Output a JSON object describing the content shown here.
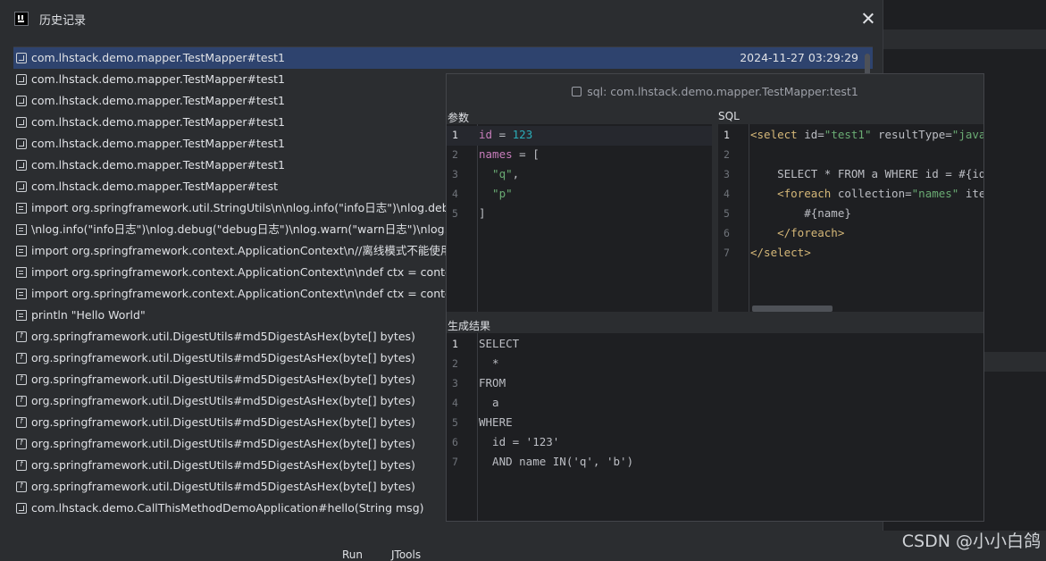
{
  "dialog": {
    "title": "历史记录",
    "close_icon": "close-icon"
  },
  "history": {
    "items": [
      {
        "icon": "class-icon",
        "label": "com.lhstack.demo.mapper.TestMapper#test1",
        "time": "2024-11-27 03:29:29",
        "selected": true
      },
      {
        "icon": "class-icon",
        "label": "com.lhstack.demo.mapper.TestMapper#test1"
      },
      {
        "icon": "class-icon",
        "label": "com.lhstack.demo.mapper.TestMapper#test1"
      },
      {
        "icon": "class-icon",
        "label": "com.lhstack.demo.mapper.TestMapper#test1"
      },
      {
        "icon": "class-icon",
        "label": "com.lhstack.demo.mapper.TestMapper#test1"
      },
      {
        "icon": "class-icon",
        "label": "com.lhstack.demo.mapper.TestMapper#test1"
      },
      {
        "icon": "class-icon",
        "label": "com.lhstack.demo.mapper.TestMapper#test"
      },
      {
        "icon": "script-icon",
        "label": "import org.springframework.util.StringUtils\\n\\nlog.info(\"info日志\")\\nlog.debug(\"debug日志\")"
      },
      {
        "icon": "script-icon",
        "label": "\\nlog.info(\"info日志\")\\nlog.debug(\"debug日志\")\\nlog.warn(\"warn日志\")\\nlog.error(\"error\")"
      },
      {
        "icon": "script-icon",
        "label": "import org.springframework.context.ApplicationContext\\n//离线模式不能使用"
      },
      {
        "icon": "script-icon",
        "label": "import org.springframework.context.ApplicationContext\\n\\ndef ctx = context"
      },
      {
        "icon": "script-icon",
        "label": "import org.springframework.context.ApplicationContext\\n\\ndef ctx = context"
      },
      {
        "icon": "script-icon",
        "label": "println \"Hello World\""
      },
      {
        "icon": "function-icon",
        "label": "org.springframework.util.DigestUtils#md5DigestAsHex(byte[] bytes)"
      },
      {
        "icon": "function-icon",
        "label": "org.springframework.util.DigestUtils#md5DigestAsHex(byte[] bytes)"
      },
      {
        "icon": "function-icon",
        "label": "org.springframework.util.DigestUtils#md5DigestAsHex(byte[] bytes)"
      },
      {
        "icon": "function-icon",
        "label": "org.springframework.util.DigestUtils#md5DigestAsHex(byte[] bytes)"
      },
      {
        "icon": "function-icon",
        "label": "org.springframework.util.DigestUtils#md5DigestAsHex(byte[] bytes)"
      },
      {
        "icon": "function-icon",
        "label": "org.springframework.util.DigestUtils#md5DigestAsHex(byte[] bytes)"
      },
      {
        "icon": "function-icon",
        "label": "org.springframework.util.DigestUtils#md5DigestAsHex(byte[] bytes)"
      },
      {
        "icon": "function-icon",
        "label": "org.springframework.util.DigestUtils#md5DigestAsHex(byte[] bytes)"
      },
      {
        "icon": "class-icon",
        "label": "com.lhstack.demo.CallThisMethodDemoApplication#hello(String msg)"
      }
    ]
  },
  "popup": {
    "title": "sql: com.lhstack.demo.mapper.TestMapper:test1",
    "params_label": "参数",
    "sql_label": "SQL",
    "result_label": "生成结果",
    "params_lines": [
      [
        [
          "tk-json-key",
          "id"
        ],
        [
          "tk-plain",
          " = "
        ],
        [
          "tk-num",
          "123"
        ]
      ],
      [
        [
          "tk-json-key",
          "names"
        ],
        [
          "tk-plain",
          " = ["
        ]
      ],
      [
        [
          "tk-json-str",
          "  \"q\""
        ],
        [
          "tk-plain",
          ","
        ]
      ],
      [
        [
          "tk-json-str",
          "  \"p\""
        ]
      ],
      [
        [
          "tk-plain",
          "]"
        ]
      ]
    ],
    "sql_lines": [
      [
        [
          "tk-tag",
          "<select "
        ],
        [
          "tk-attr",
          "id="
        ],
        [
          "tk-str",
          "\"test1\""
        ],
        [
          "tk-attr",
          " resultType="
        ],
        [
          "tk-str",
          "\"java."
        ]
      ],
      [],
      [
        [
          "tk-plain",
          "    SELECT * FROM a WHERE id = #{id}"
        ]
      ],
      [
        [
          "tk-tag",
          "    <foreach "
        ],
        [
          "tk-attr",
          "collection="
        ],
        [
          "tk-str",
          "\"names\""
        ],
        [
          "tk-attr",
          " item"
        ]
      ],
      [
        [
          "tk-plain",
          "        #{name}"
        ]
      ],
      [
        [
          "tk-tag",
          "    </foreach>"
        ]
      ],
      [
        [
          "tk-tag",
          "</select>"
        ]
      ]
    ],
    "result_lines": [
      [
        [
          "tk-plain",
          "SELECT"
        ]
      ],
      [
        [
          "tk-plain",
          "  *"
        ]
      ],
      [
        [
          "tk-plain",
          "FROM"
        ]
      ],
      [
        [
          "tk-plain",
          "  a"
        ]
      ],
      [
        [
          "tk-plain",
          "WHERE"
        ]
      ],
      [
        [
          "tk-plain",
          "  id = '123'"
        ]
      ],
      [
        [
          "tk-plain",
          "  AND name IN('q', 'b')"
        ]
      ]
    ]
  },
  "background": {
    "tab_run": "Run",
    "tab_jtools": "JTools"
  },
  "watermark": "CSDN @小小白鸽"
}
